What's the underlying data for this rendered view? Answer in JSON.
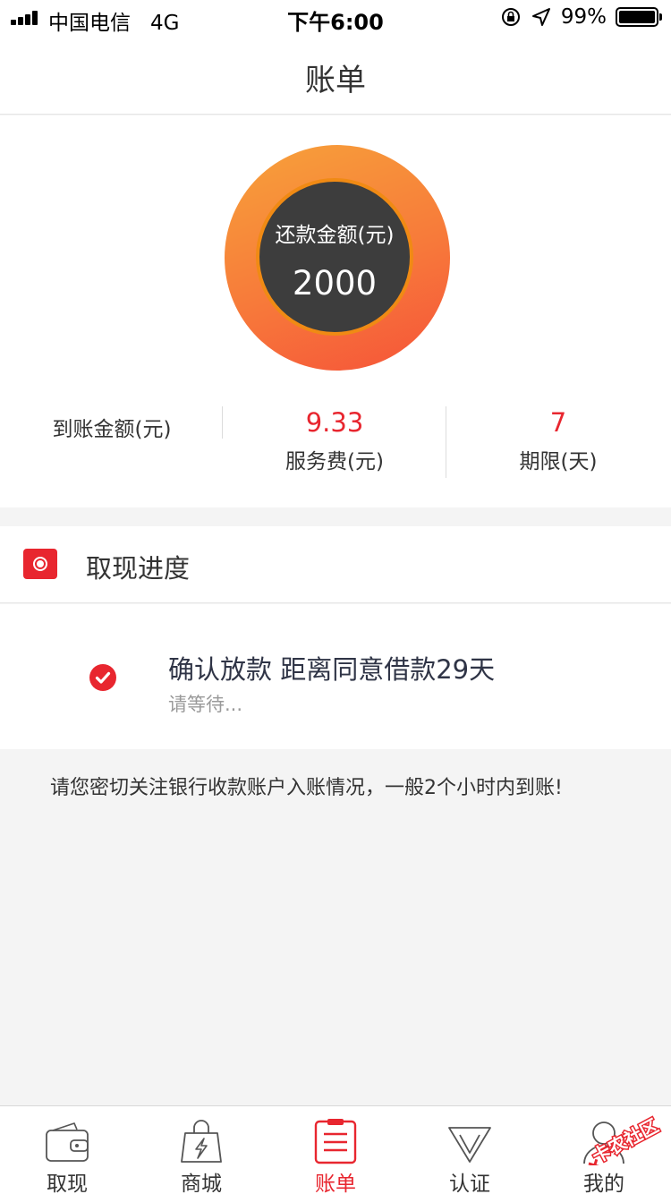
{
  "status_bar": {
    "carrier": "中国电信",
    "network": "4G",
    "time": "下午6:00",
    "battery": "99%",
    "battery_level": 0.99
  },
  "header": {
    "title": "账单"
  },
  "summary": {
    "repay_label": "还款金额(元)",
    "repay_amount": "2000",
    "received_label": "到账金额(元)",
    "fee_value": "9.33",
    "fee_label": "服务费(元)",
    "term_value": "7",
    "term_label": "期限(天)"
  },
  "progress": {
    "section_title": "取现进度",
    "step_title": "确认放款 距离同意借款29天",
    "step_subtitle": "请等待...",
    "notice": "请您密切关注银行收款账户入账情况，一般2个小时内到账!"
  },
  "tabbar": {
    "items": [
      {
        "label": "取现",
        "icon": "wallet-icon",
        "active": false
      },
      {
        "label": "商城",
        "icon": "shopping-bag-icon",
        "active": false
      },
      {
        "label": "账单",
        "icon": "bill-icon",
        "active": true
      },
      {
        "label": "认证",
        "icon": "verify-icon",
        "active": false
      },
      {
        "label": "我的",
        "icon": "user-icon",
        "active": false
      }
    ]
  },
  "watermark": {
    "text": "卡农社区"
  },
  "colors": {
    "accent": "#e8262f",
    "donut_start": "#f7a23a",
    "donut_end": "#f65339",
    "donut_center": "#3d3d3d"
  }
}
